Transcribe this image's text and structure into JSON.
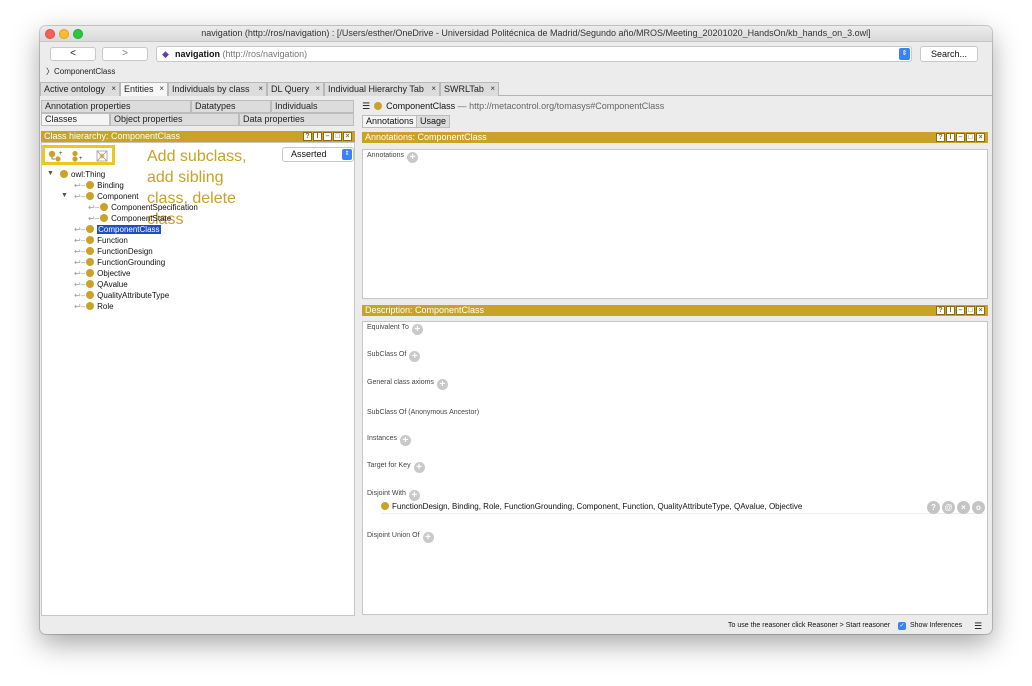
{
  "window": {
    "title": "navigation (http://ros/navigation)  : [/Users/esther/OneDrive - Universidad Politécnica de Madrid/Segundo año/MROS/Meeting_20201020_HandsOn/kb_hands_on_3.owl]"
  },
  "nav": {
    "back_label": "<",
    "forward_label": ">",
    "ontology_name": "navigation",
    "ontology_iri": "(http://ros/navigation)",
    "search_label": "Search..."
  },
  "breadcrumb": "ComponentClass",
  "tabs": [
    {
      "label": "Active ontology",
      "close": "×"
    },
    {
      "label": "Entities",
      "close": "×"
    },
    {
      "label": "Individuals by class",
      "close": "×"
    },
    {
      "label": "DL Query",
      "close": "×"
    },
    {
      "label": "Individual Hierarchy Tab",
      "close": "×"
    },
    {
      "label": "SWRLTab",
      "close": "×"
    }
  ],
  "left": {
    "subtabs_row1": [
      "Annotation properties",
      "Datatypes",
      "Individuals"
    ],
    "subtabs_row2": [
      "Classes",
      "Object properties",
      "Data properties"
    ],
    "header": "Class hierarchy: ComponentClass",
    "mode_select": "Asserted",
    "annotation_text": "Add subclass, add sibling class, delete class",
    "tree": {
      "root": "owl:Thing",
      "items": [
        "Binding",
        "Component",
        "ComponentSpecification",
        "ComponentState",
        "ComponentClass",
        "Function",
        "FunctionDesign",
        "FunctionGrounding",
        "Objective",
        "QAvalue",
        "QualityAttributeType",
        "Role"
      ]
    }
  },
  "right": {
    "entity_name": "ComponentClass",
    "entity_iri": "— http://metacontrol.org/tomasys#ComponentClass",
    "tabs": [
      "Annotations",
      "Usage"
    ],
    "annotations_header": "Annotations: ComponentClass",
    "annotations_label": "Annotations",
    "description_header": "Description: ComponentClass",
    "sections": {
      "equivalent": "Equivalent To",
      "subclass": "SubClass Of",
      "general": "General class axioms",
      "subclass_anon": "SubClass Of (Anonymous Ancestor)",
      "instances": "Instances",
      "target_key": "Target for Key",
      "disjoint": "Disjoint With",
      "disjoint_union": "Disjoint Union Of"
    },
    "disjoint_value": "FunctionDesign, Binding, Role, FunctionGrounding, Component, Function, QualityAttributeType, QAvalue, Objective"
  },
  "status": {
    "reasoner_hint": "To use the reasoner click Reasoner > Start reasoner",
    "show_inferences": "Show Inferences"
  },
  "colors": {
    "accent": "#c9a227",
    "selection": "#1e4fc7",
    "highlight_box": "#ecc625"
  }
}
